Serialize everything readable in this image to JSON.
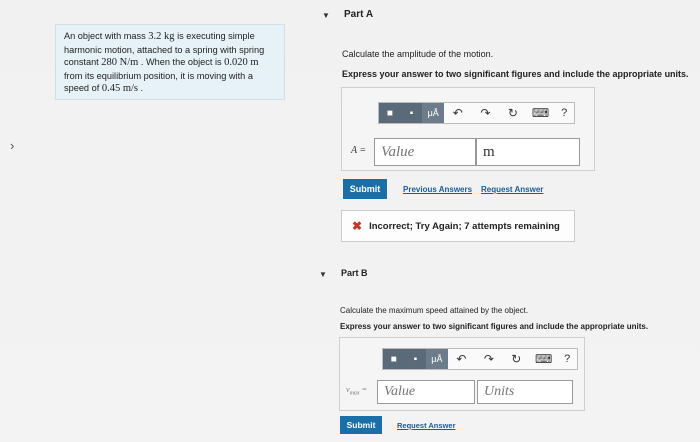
{
  "problem": {
    "line1": "An object with mass ",
    "mass": "3.2 kg",
    "line1b": " is executing simple",
    "line2": "harmonic motion, attached to a spring with spring",
    "line3a": "constant ",
    "k": "280 N/m",
    "line3b": " . When the object is ",
    "x": "0.020 m",
    "line4": "from its equilibrium position, it is moving with a",
    "line5a": "speed of ",
    "v": "0.45 m/s",
    "line5b": " ."
  },
  "partA": {
    "title": "Part A",
    "question": "Calculate the amplitude of the motion.",
    "instruction": "Express your answer to two significant figures and include the appropriate units.",
    "var_label": "A =",
    "value_placeholder": "Value",
    "units_value": "m",
    "submit": "Submit",
    "prev_answers": "Previous Answers",
    "request_answer": "Request Answer",
    "feedback": "Incorrect; Try Again; 7 attempts remaining"
  },
  "partB": {
    "title": "Part B",
    "question": "Calculate the maximum speed attained by the object.",
    "instruction": "Express your answer to two significant figures and include the appropriate units.",
    "var_label": "v",
    "var_sub": "max",
    "var_eq": " =",
    "value_placeholder": "Value",
    "units_placeholder": "Units",
    "submit": "Submit",
    "request_answer": "Request Answer"
  },
  "toolbar": {
    "templates": "■",
    "mu": "μÅ",
    "undo": "↶",
    "redo": "↷",
    "reset": "↻",
    "keyboard": "⌨",
    "help": "?"
  },
  "icons": {
    "left_chevron": "›",
    "toggle": "▼"
  }
}
